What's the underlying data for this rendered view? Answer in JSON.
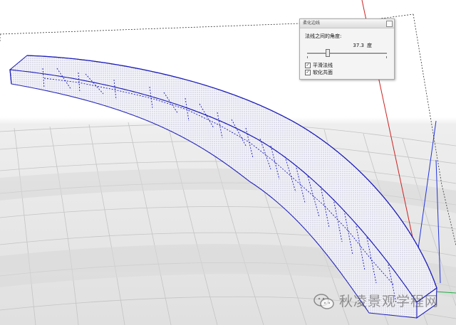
{
  "dialog": {
    "title": "柔化边线",
    "angle_label": "法线之间的角度:",
    "angle_value": "37.3",
    "angle_unit": "度",
    "slider_fraction": 0.25,
    "checkbox_smooth": {
      "label": "平滑法线",
      "checked": true
    },
    "checkbox_soften": {
      "label": "软化共面",
      "checked": true
    }
  },
  "watermark": {
    "text": "秋凌景观学程网",
    "logo": "wechat-logo-icon"
  },
  "colors": {
    "model_edge": "#1d1db8",
    "red_axis": "#cc2222",
    "blue_axis": "#2233dd",
    "face": "#f3f3f8"
  }
}
